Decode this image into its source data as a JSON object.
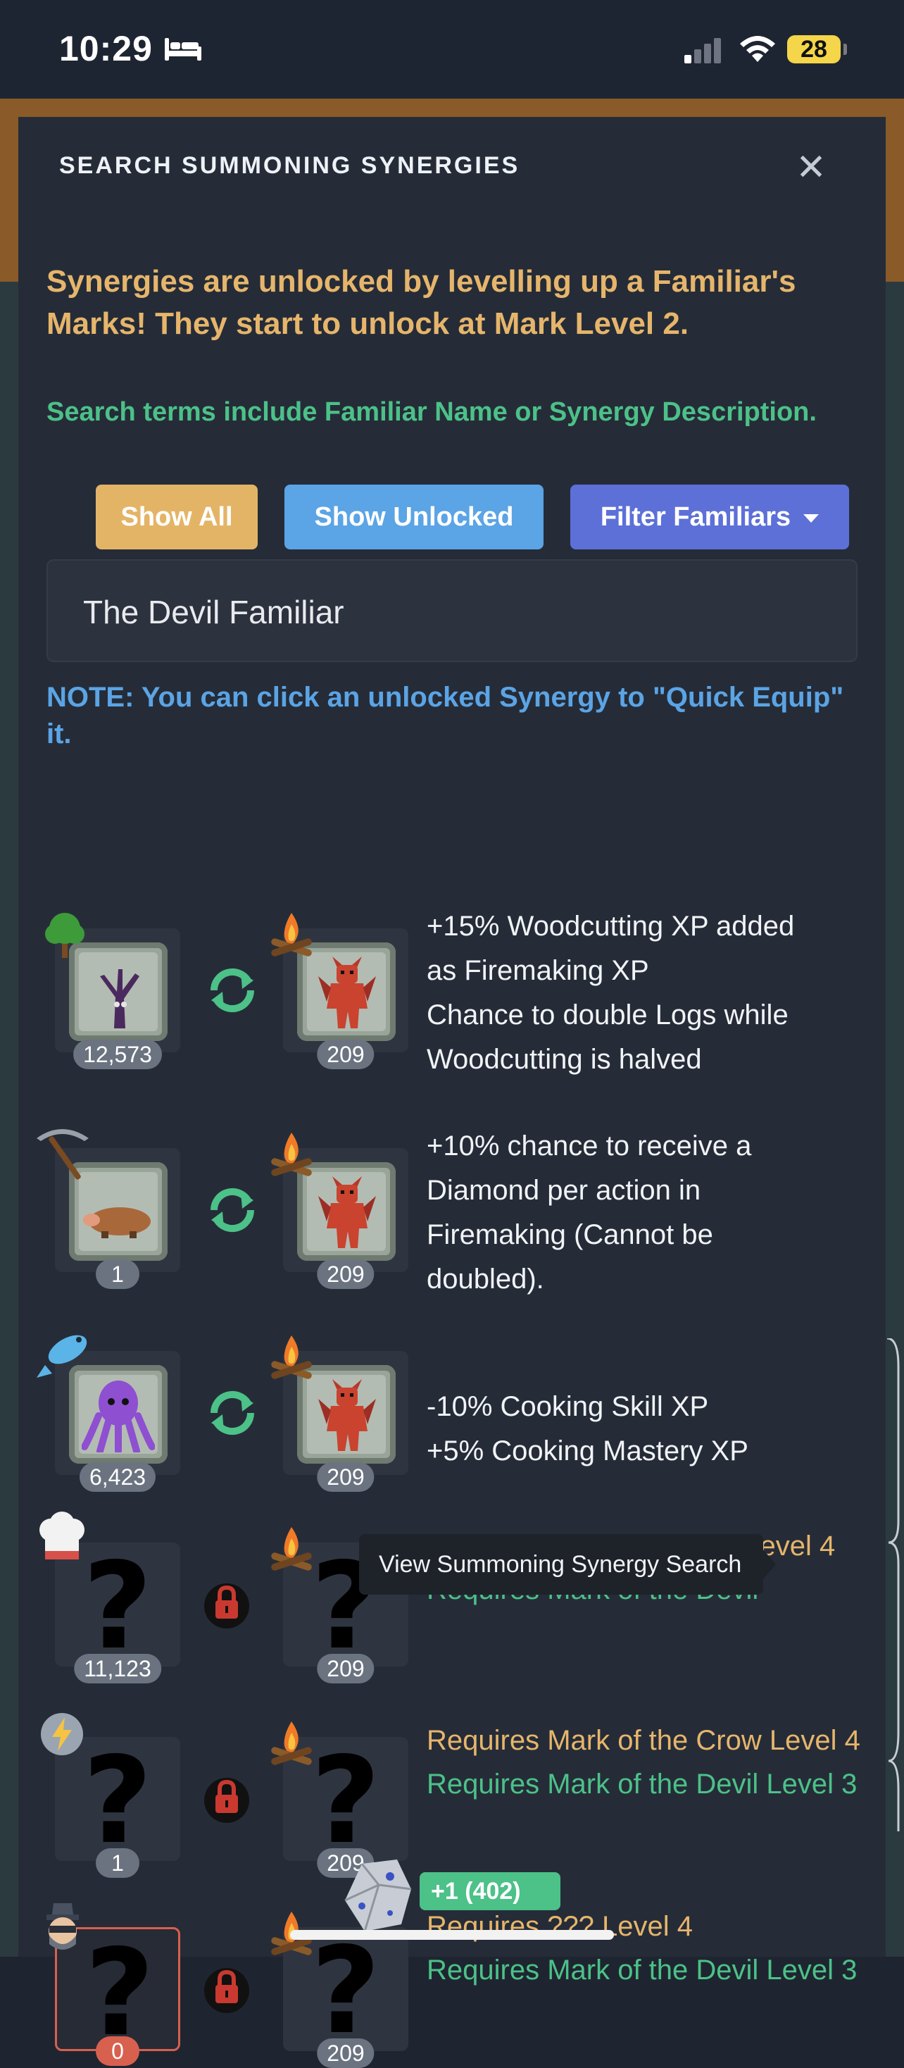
{
  "status_bar": {
    "time": "10:29",
    "battery": "28"
  },
  "modal": {
    "title": "SEARCH SUMMONING SYNERGIES",
    "close_label": "✕",
    "info_orange": "Synergies are unlocked by levelling up a Familiar's Marks! They start to unlock at Mark Level 2.",
    "info_green": "Search terms include Familiar Name or Synergy Description.",
    "buttons": {
      "show_all": "Show All",
      "show_unlocked": "Show Unlocked",
      "filter_familiars": "Filter Familiars"
    },
    "search_value": "The Devil Familiar",
    "note": "NOTE: You can click an unlocked Synergy to \"Quick Equip\" it."
  },
  "rows": [
    {
      "left_count": "12,573",
      "right_count": "209",
      "lines": [
        "+15% Woodcutting XP added",
        "as Firemaking XP",
        "Chance to double Logs while",
        "Woodcutting is halved"
      ]
    },
    {
      "left_count": "1",
      "right_count": "209",
      "lines": [
        "+10% chance to receive a",
        "Diamond per action in",
        "Firemaking (Cannot be",
        "doubled)."
      ]
    },
    {
      "left_count": "6,423",
      "right_count": "209",
      "lines": [
        "-10% Cooking Skill XP",
        "+5% Cooking Mastery XP"
      ]
    },
    {
      "left_count": "11,123",
      "right_count": "209",
      "req_1": "Requires Mark of the Pig Level 4",
      "req_2": "Requires Mark of the Devil"
    },
    {
      "left_count": "1",
      "right_count": "209",
      "req_1": "Requires Mark of the Crow Level 4",
      "req_2": "Requires Mark of the Devil Level 3"
    },
    {
      "left_count": "0",
      "right_count": "209",
      "req_1": "Requires ??? Level 4",
      "req_2": "Requires Mark of the Devil Level 3"
    }
  ],
  "tooltip": "View Summoning Synergy Search",
  "xp_popup": "+1  (402)",
  "colors": {
    "accent_orange": "#e6b56b",
    "accent_green": "#4cc188",
    "accent_blue": "#5ba4e5",
    "filter_blue": "#5d70d8",
    "modal_bg": "#252c38"
  },
  "icons": {
    "status": [
      "bed-icon",
      "signal-icon",
      "wifi-icon",
      "battery-icon"
    ],
    "skills": [
      "woodcutting-tree-icon",
      "mining-pickaxe-icon",
      "fishing-fish-icon",
      "cooking-chef-hat-icon",
      "magic-lightning-icon",
      "thieving-bandit-icon",
      "firemaking-campfire-icon"
    ],
    "synergy": [
      "sync-arrows-icon",
      "padlock-icon"
    ]
  }
}
